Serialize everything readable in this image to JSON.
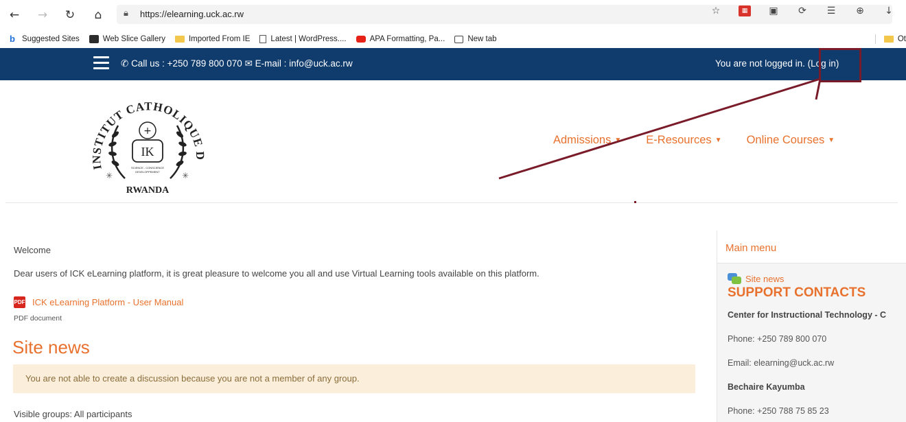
{
  "browser": {
    "url": "https://elearning.uck.ac.rw",
    "bookmarks": [
      {
        "label": "Suggested Sites",
        "icon": "bing-icon"
      },
      {
        "label": "Web Slice Gallery",
        "icon": "web-slice-icon"
      },
      {
        "label": "Imported From IE",
        "icon": "folder-icon"
      },
      {
        "label": "Latest | WordPress....",
        "icon": "page-icon"
      },
      {
        "label": "APA Formatting, Pa...",
        "icon": "youtube-icon"
      },
      {
        "label": "New tab",
        "icon": "tab-icon"
      }
    ],
    "other_favorites": "Ot"
  },
  "navbar": {
    "contact": "Call us : +250 789 800 070 ✉ E-mail : info@uck.ac.rw",
    "login_text": "You are not logged in.",
    "login_link": "(Log in)"
  },
  "logo": {
    "arc_text": "INSTITUT CATHOLIQUE DE KABGAYI",
    "bottom_text": "RWANDA",
    "monogram": "IK",
    "motto_1": "SCIENCE - CONSCIENCE",
    "motto_2": "DEVELOPPEMENT"
  },
  "menu": [
    "Admissions",
    "E-Resources",
    "Online Courses"
  ],
  "main": {
    "welcome_heading": "Welcome",
    "welcome_text": "Dear users of ICK eLearning platform, it is great pleasure to welcome you all and use Virtual Learning tools available on this platform.",
    "pdf_link": "ICK eLearning Platform - User Manual",
    "pdf_meta": "PDF document",
    "site_news_heading": "Site news",
    "alert": "You are not able to create a discussion because you are not a member of any group.",
    "groups": "Visible groups: All participants"
  },
  "block": {
    "title": "Main menu",
    "news_link": "Site news",
    "support_title": "SUPPORT CONTACTS",
    "center": "Center for Instructional Technology - C",
    "phone1": "Phone: +250 789 800 070",
    "email": "Email: elearning@uck.ac.rw",
    "person": "Bechaire Kayumba",
    "phone2": "Phone: +250 788 75 85 23"
  },
  "colors": {
    "navbar": "#0f3b6d",
    "accent": "#e8712d",
    "annotation": "#7a1b2a",
    "alert_bg": "#fbeedb"
  }
}
